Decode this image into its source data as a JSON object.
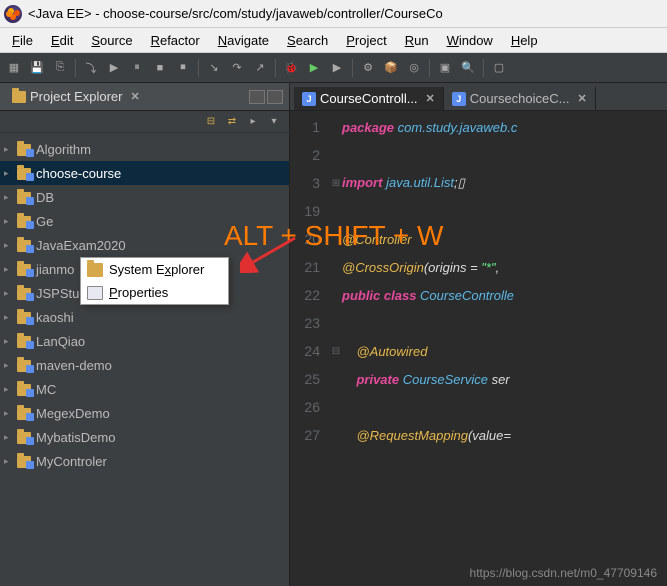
{
  "title": "<Java EE> - choose-course/src/com/study/javaweb/controller/CourseCo",
  "menus": [
    "File",
    "Edit",
    "Source",
    "Refactor",
    "Navigate",
    "Search",
    "Project",
    "Run",
    "Window",
    "Help"
  ],
  "sidebar": {
    "title": "Project Explorer",
    "projects": [
      "Algorithm",
      "choose-course",
      "DB",
      "Ge",
      "JavaExam2020",
      "jianmo",
      "JSPStudy",
      "kaoshi",
      "LanQiao",
      "maven-demo",
      "MC",
      "MegexDemo",
      "MybatisDemo",
      "MyControler"
    ],
    "selected": 1
  },
  "contextMenu": {
    "items": [
      "System Explorer",
      "Properties"
    ],
    "underlines": [
      "x",
      "P"
    ]
  },
  "editor": {
    "tabs": [
      {
        "label": "CourseControll...",
        "active": true
      },
      {
        "label": "CoursechoiceC...",
        "active": false
      }
    ],
    "lines": [
      {
        "n": "1",
        "tokens": [
          [
            "kw",
            "package"
          ],
          [
            "pln",
            " "
          ],
          [
            "type",
            "com.study.javaweb.c"
          ]
        ]
      },
      {
        "n": "2",
        "tokens": []
      },
      {
        "n": "3",
        "fold": "⊞",
        "tokens": [
          [
            "kw",
            "import"
          ],
          [
            "pln",
            " "
          ],
          [
            "type",
            "java.util.List"
          ],
          [
            "op",
            ";▯"
          ]
        ]
      },
      {
        "n": "19",
        "tokens": []
      },
      {
        "n": "20",
        "tokens": [
          [
            "ann",
            "@Controller"
          ]
        ]
      },
      {
        "n": "21",
        "tokens": [
          [
            "ann",
            "@CrossOrigin"
          ],
          [
            "op",
            "("
          ],
          [
            "pln",
            "origins"
          ],
          [
            "op",
            " = "
          ],
          [
            "str",
            "\"*\""
          ],
          [
            "op",
            ", "
          ]
        ]
      },
      {
        "n": "22",
        "tokens": [
          [
            "kw",
            "public class "
          ],
          [
            "type",
            "CourseControlle"
          ]
        ]
      },
      {
        "n": "23",
        "tokens": []
      },
      {
        "n": "24",
        "fold": "⊟",
        "indent": "    ",
        "tokens": [
          [
            "ann",
            "@Autowired"
          ]
        ]
      },
      {
        "n": "25",
        "indent": "    ",
        "tokens": [
          [
            "kw",
            "private "
          ],
          [
            "type",
            "CourseService"
          ],
          [
            "pln",
            " ser"
          ]
        ]
      },
      {
        "n": "26",
        "tokens": []
      },
      {
        "n": "27",
        "indent": "    ",
        "tokens": [
          [
            "ann",
            "@RequestMapping"
          ],
          [
            "op",
            "("
          ],
          [
            "pln",
            "value="
          ]
        ]
      }
    ]
  },
  "overlay": "ALT + SHIFT + W",
  "watermark": "https://blog.csdn.net/m0_47709146"
}
